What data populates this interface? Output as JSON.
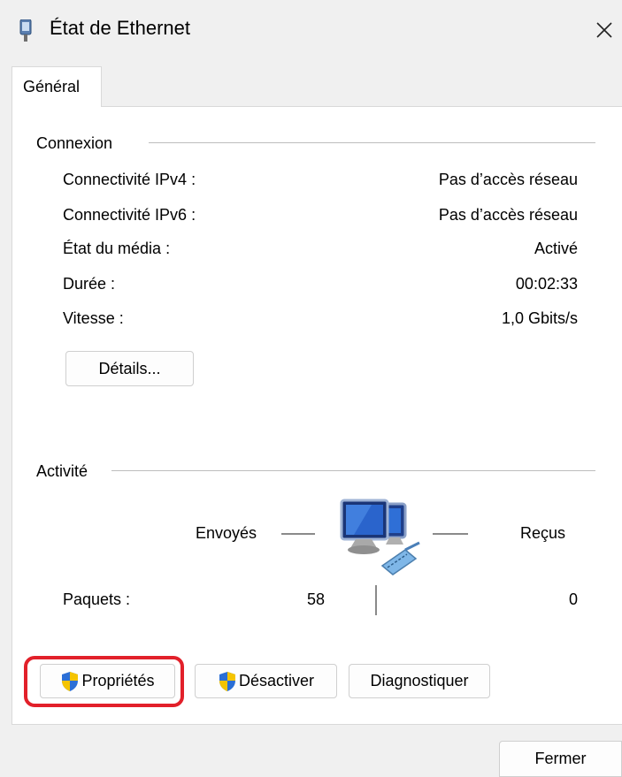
{
  "window": {
    "title": "État de Ethernet",
    "icon": "ethernet-adapter-icon",
    "close_icon": "close-icon"
  },
  "tabs": [
    {
      "label": "Général",
      "selected": true
    }
  ],
  "connection": {
    "group_label": "Connexion",
    "rows": [
      {
        "label": "Connectivité IPv4 :",
        "value": "Pas d’accès réseau"
      },
      {
        "label": "Connectivité IPv6 :",
        "value": "Pas d’accès réseau"
      },
      {
        "label": "État du média :",
        "value": "Activé"
      },
      {
        "label": "Durée :",
        "value": "00:02:33"
      },
      {
        "label": "Vitesse :",
        "value": "1,0 Gbits/s"
      }
    ],
    "details_button": "Détails..."
  },
  "activity": {
    "group_label": "Activité",
    "sent_label": "Envoyés",
    "received_label": "Reçus",
    "packets_label": "Paquets :",
    "packets_sent": "58",
    "packets_received": "0",
    "graphic_icon": "network-computers-icon"
  },
  "actions": {
    "properties": "Propriétés",
    "disable": "Désactiver",
    "diagnose": "Diagnostiquer",
    "shield_icon": "uac-shield-icon",
    "highlight_color": "#e2202a"
  },
  "footer": {
    "close_button": "Fermer"
  }
}
